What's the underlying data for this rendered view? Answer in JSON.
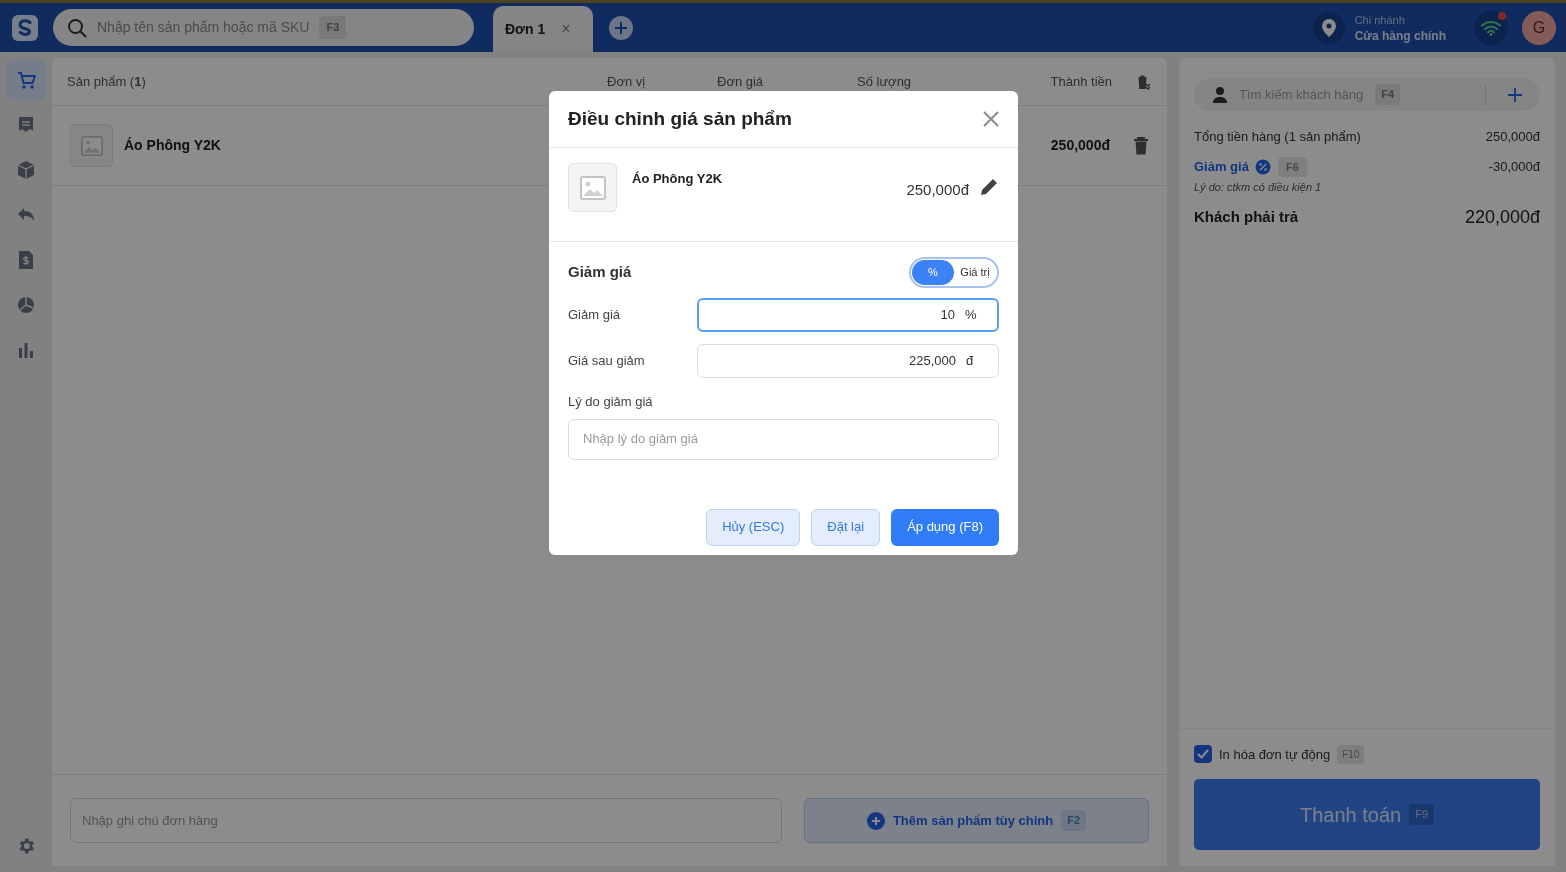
{
  "header": {
    "search_placeholder": "Nhập tên sản phẩm hoặc mã SKU",
    "search_key": "F3",
    "tabs": [
      {
        "label": "Đơn 1",
        "selected": true,
        "close": "×"
      }
    ],
    "branch_label": "Chi nhánh",
    "branch_value": "Cửa hàng chính",
    "avatar": "G"
  },
  "sidebar": {
    "items": [
      {
        "kind": "cart",
        "selected": true
      },
      {
        "kind": "receipt",
        "selected": false
      },
      {
        "kind": "box",
        "selected": false
      },
      {
        "kind": "return",
        "selected": false
      },
      {
        "kind": "invoice",
        "selected": false
      },
      {
        "kind": "pie",
        "selected": false
      },
      {
        "kind": "bars",
        "selected": false
      }
    ]
  },
  "products": {
    "columns": [
      "Sản phẩm (**1**)",
      "Đơn vị",
      "Đơn giá",
      "Số lượng",
      "Thành tiền"
    ],
    "rows": [
      {
        "name": "Áo Phông Y2K",
        "total": "250,000đ"
      }
    ],
    "note_placeholder": "Nhập ghi chú đơn hàng",
    "custom_button": "Thêm sản phẩm tùy chỉnh",
    "custom_key": "F2"
  },
  "summary": {
    "customer_placeholder": "Tìm kiếm khách hàng",
    "customer_key": "F4",
    "lines": [
      {
        "kind": "plain",
        "label": "Tổng tiền hàng (1 sản phẩm)",
        "value": "250,000đ"
      },
      {
        "kind": "discount",
        "label": "Giảm giá",
        "key": "F6",
        "value": "-30,000đ",
        "note": "Lý do: ctkm có điều kiện 1"
      },
      {
        "kind": "total",
        "label": "Khách phải trả",
        "value": "220,000đ"
      }
    ],
    "auto_print": {
      "label": "In hóa đơn tự động",
      "key": "F10",
      "checked": true
    },
    "pay_button": "Thanh toán",
    "pay_key": "F9"
  },
  "modal": {
    "title": "Điều chỉnh giá sản phẩm",
    "product_name": "Áo Phông Y2K",
    "price": "250,000đ",
    "section": "Giảm giá",
    "toggle": [
      {
        "label": "%",
        "selected": true
      },
      {
        "label": "Giá trị",
        "selected": false
      }
    ],
    "fields": [
      {
        "label": "Giảm giá",
        "value": "10",
        "unit": "%",
        "focused": true
      },
      {
        "label": "Giá sau giảm",
        "value": "225,000",
        "unit": "đ",
        "focused": false
      }
    ],
    "reason_label": "Lý do giảm giá",
    "reason_placeholder": "Nhập lý do giảm giá",
    "buttons": [
      {
        "label": "Hủy (ESC)",
        "kind": "secondary"
      },
      {
        "label": "Đặt lại",
        "kind": "secondary"
      },
      {
        "label": "Áp dụng (F8)",
        "kind": "primary"
      }
    ]
  }
}
